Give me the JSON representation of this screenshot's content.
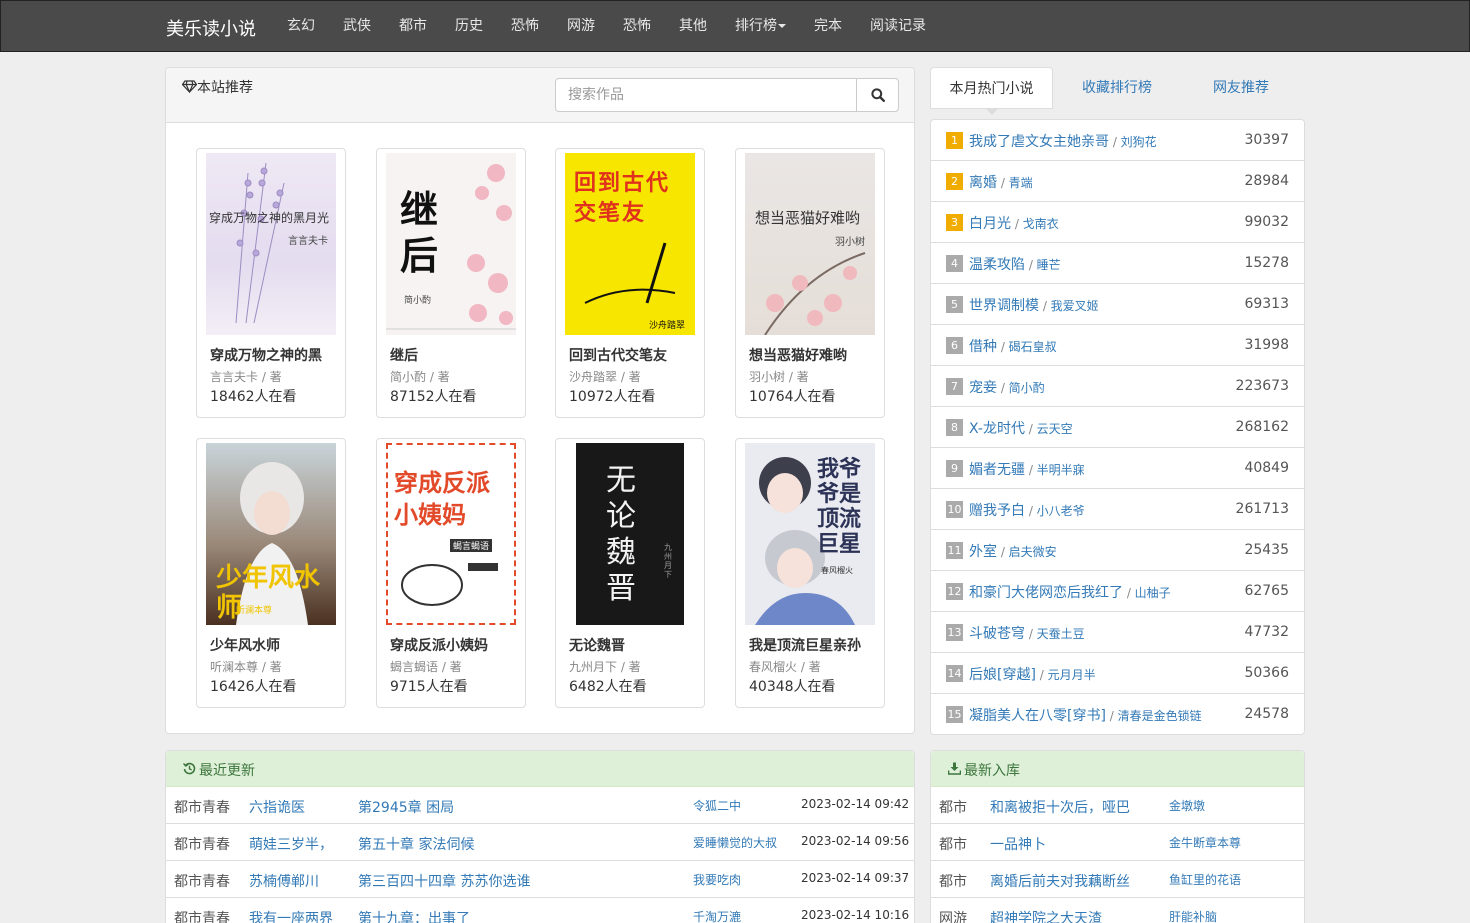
{
  "navbar": {
    "brand": "美乐读小说",
    "links": [
      "玄幻",
      "武侠",
      "都市",
      "历史",
      "恐怖",
      "网游",
      "恐怖",
      "其他",
      "排行榜",
      "完本",
      "阅读记录"
    ]
  },
  "recommend": {
    "title": "本站推荐",
    "search_placeholder": "搜索作品",
    "books": [
      {
        "title": "穿成万物之神的黑",
        "author": "言言夫卡 / 著",
        "readers": "18462人在看",
        "cover_text": "穿成万物之神的黑月光",
        "cover_sub": "言言夫卡",
        "cover_bg": "#ece6f3"
      },
      {
        "title": "继后",
        "author": "简小酌 / 著",
        "readers": "87152人在看",
        "cover_text": "继后",
        "cover_sub": "简小酌",
        "cover_bg": "#f6f1f1"
      },
      {
        "title": "回到古代交笔友",
        "author": "沙舟踏翠 / 著",
        "readers": "10972人在看",
        "cover_text": "回到古代交笔友",
        "cover_sub": "沙舟踏翠",
        "cover_bg": "#f5e400"
      },
      {
        "title": "想当恶猫好难哟",
        "author": "羽小树 / 著",
        "readers": "10764人在看",
        "cover_text": "想当恶猫好难哟",
        "cover_sub": "羽小树",
        "cover_bg": "#e9e3e0"
      },
      {
        "title": "少年风水师",
        "author": "听澜本尊 / 著",
        "readers": "16426人在看",
        "cover_text": "少年风水师",
        "cover_sub": "听澜本尊",
        "cover_bg": "#6a5040"
      },
      {
        "title": "穿成反派小姨妈",
        "author": "蝎言蝎语 / 著",
        "readers": "9715人在看",
        "cover_text": "穿成反派小姨妈",
        "cover_sub": "蝎言蝎语",
        "cover_bg": "#ffffff"
      },
      {
        "title": "无论魏晋",
        "author": "九州月下 / 著",
        "readers": "6482人在看",
        "cover_text": "无论魏晋",
        "cover_sub": "九州月下",
        "cover_bg": "#1a1a1a"
      },
      {
        "title": "我是顶流巨星亲孙",
        "author": "春风榴火 / 著",
        "readers": "40348人在看",
        "cover_text": "我爷爷是顶流巨星",
        "cover_sub": "春风榴火",
        "cover_bg": "#e6e8ee"
      }
    ]
  },
  "tabs": [
    "本月热门小说",
    "收藏排行榜",
    "网友推荐"
  ],
  "ranking": [
    {
      "n": "1",
      "title": "我成了虐文女主她亲哥",
      "author": "刘狗花",
      "count": "30397",
      "color": "#f0ad00"
    },
    {
      "n": "2",
      "title": "离婚",
      "author": "青端",
      "count": "28984",
      "color": "#f0ad00"
    },
    {
      "n": "3",
      "title": "白月光",
      "author": "戈南衣",
      "count": "99032",
      "color": "#f0ad00"
    },
    {
      "n": "4",
      "title": "温柔攻陷",
      "author": "睡芒",
      "count": "15278",
      "color": "#aaaaaa"
    },
    {
      "n": "5",
      "title": "世界调制模",
      "author": "我爱叉姬",
      "count": "69313",
      "color": "#aaaaaa"
    },
    {
      "n": "6",
      "title": "借种",
      "author": "碣石皇叔",
      "count": "31998",
      "color": "#aaaaaa"
    },
    {
      "n": "7",
      "title": "宠妾",
      "author": "简小酌",
      "count": "223673",
      "color": "#aaaaaa"
    },
    {
      "n": "8",
      "title": "X-龙时代",
      "author": "云天空",
      "count": "268162",
      "color": "#aaaaaa"
    },
    {
      "n": "9",
      "title": "媚者无疆",
      "author": "半明半寐",
      "count": "40849",
      "color": "#aaaaaa"
    },
    {
      "n": "10",
      "title": "赠我予白",
      "author": "小八老爷",
      "count": "261713",
      "color": "#aaaaaa"
    },
    {
      "n": "11",
      "title": "外室",
      "author": "启夫微安",
      "count": "25435",
      "color": "#aaaaaa"
    },
    {
      "n": "12",
      "title": "和豪门大佬网恋后我红了",
      "author": "山柚子",
      "count": "62765",
      "color": "#aaaaaa"
    },
    {
      "n": "13",
      "title": "斗破苍穹",
      "author": "天蚕土豆",
      "count": "47732",
      "color": "#aaaaaa"
    },
    {
      "n": "14",
      "title": "后娘[穿越]",
      "author": "元月月半",
      "count": "50366",
      "color": "#aaaaaa"
    },
    {
      "n": "15",
      "title": "凝脂美人在八零[穿书]",
      "author": "清春是金色锁链",
      "count": "24578",
      "color": "#aaaaaa"
    }
  ],
  "updates": {
    "title": "最近更新",
    "rows": [
      {
        "cat": "都市青春",
        "book": "六指诡医",
        "chapter": "第2945章 困局",
        "author": "令狐二中",
        "time": "2023-02-14 09:42"
      },
      {
        "cat": "都市青春",
        "book": "萌娃三岁半，",
        "chapter": "第五十章 家法伺候",
        "author": "爱睡懒觉的大叔",
        "time": "2023-02-14 09:56"
      },
      {
        "cat": "都市青春",
        "book": "苏楠傅郸川",
        "chapter": "第三百四十四章 苏苏你选谁",
        "author": "我要吃肉",
        "time": "2023-02-14 09:37"
      },
      {
        "cat": "都市青春",
        "book": "我有一座两界",
        "chapter": "第十九章：出事了",
        "author": "千淘万漉",
        "time": "2023-02-14 10:16"
      }
    ]
  },
  "newest": {
    "title": "最新入库",
    "rows": [
      {
        "cat": "都市",
        "book": "和离被拒十次后，哑巴",
        "author": "金墩墩"
      },
      {
        "cat": "都市",
        "book": "一品神卜",
        "author": "金牛断章本尊"
      },
      {
        "cat": "都市",
        "book": "离婚后前夫对我藕断丝",
        "author": "鱼缸里的花语"
      },
      {
        "cat": "网游",
        "book": "超神学院之大天渣",
        "author": "肝能补脑"
      }
    ]
  }
}
